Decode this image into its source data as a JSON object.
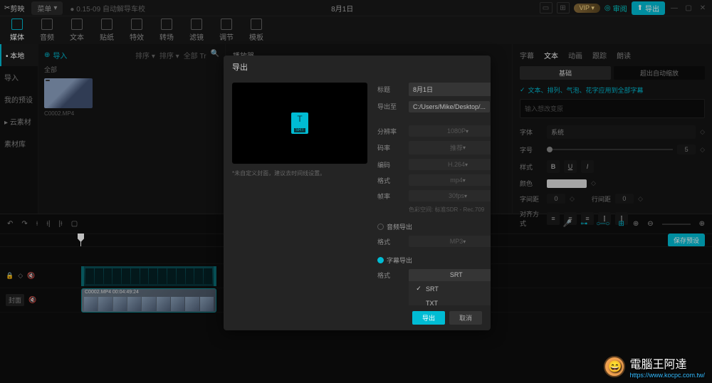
{
  "titlebar": {
    "app": "剪映",
    "menu": "菜单",
    "docname": "0.15-09 自动解导车校",
    "center_title": "8月1日",
    "vip": "VIP",
    "review": "审阅",
    "export": "导出"
  },
  "ribbon": [
    {
      "label": "媒体",
      "active": true
    },
    {
      "label": "音频"
    },
    {
      "label": "文本"
    },
    {
      "label": "贴纸"
    },
    {
      "label": "特效"
    },
    {
      "label": "转场"
    },
    {
      "label": "滤镜"
    },
    {
      "label": "调节"
    },
    {
      "label": "模板"
    }
  ],
  "left_tabs": [
    {
      "label": "本地",
      "active": true
    },
    {
      "label": "导入"
    },
    {
      "label": "我的预设"
    },
    {
      "label": "云素材",
      "caret": true
    },
    {
      "label": "素材库"
    }
  ],
  "media": {
    "import": "导入",
    "category": "全部",
    "thumb_label": "C0002.MP4"
  },
  "player": {
    "title": "播放器"
  },
  "filterbar": {
    "sort1": "排序",
    "sort2": "排序",
    "all": "全部"
  },
  "props": {
    "tabs": [
      "字幕",
      "文本",
      "动画",
      "跟踪",
      "朗读"
    ],
    "active_tab": "文本",
    "subtabs": [
      "基础",
      "超出自动缩放"
    ],
    "active_subtab": "基础",
    "hint": "文本、排列、气泡、花字应用到全部字幕",
    "placeholder": "输入想改变原",
    "font_label": "字体",
    "font_value": "系统",
    "size_label": "字号",
    "size_value": "5",
    "style_label": "样式",
    "color_label": "颜色",
    "spacing_label": "字间距",
    "spacing_value": "0",
    "lineheight_label": "行间距",
    "lineheight_value": "0",
    "align_label": "对齐方式",
    "save_preset": "保存预设"
  },
  "modal": {
    "title": "导出",
    "cover_hint": "*未自定义封面，建议去时间线设置。",
    "fields": {
      "title_label": "标题",
      "title_value": "8月1日",
      "path_label": "导出至",
      "path_value": "C:/Users/Mike/Desktop/...",
      "res_label": "分辨率",
      "res_value": "1080P",
      "bitrate_label": "码率",
      "bitrate_value": "推荐",
      "codec_label": "编码",
      "codec_value": "H.264",
      "format_label": "格式",
      "format_value": "mp4",
      "fps_label": "帧率",
      "fps_value": "30fps",
      "size_hint": "色彩空间: 标准SDR - Rec.709",
      "audio_section": "音频导出",
      "audio_format_label": "格式",
      "audio_format_value": "MP3",
      "subtitle_section": "字幕导出",
      "subtitle_format_label": "格式",
      "subtitle_format_value": "SRT"
    },
    "dropdown_options": [
      "SRT",
      "TXT"
    ],
    "export_btn": "导出",
    "cancel_btn": "取消"
  },
  "timeline": {
    "video_meta": "C0002.MP4  00:04:49:24"
  },
  "watermark": {
    "name": "電腦王阿達",
    "url": "https://www.kocpc.com.tw/"
  }
}
